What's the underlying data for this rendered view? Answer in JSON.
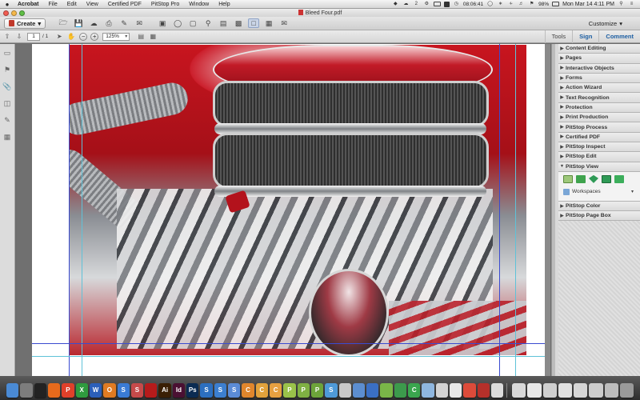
{
  "menubar": {
    "app": "Acrobat",
    "items": [
      "File",
      "Edit",
      "View",
      "Certified PDF",
      "PitStop Pro",
      "Window",
      "Help"
    ],
    "tray_count": "2",
    "clock_small": "08:06:41",
    "battery": "98%",
    "datetime": "Mon Mar 14  4:11 PM"
  },
  "window": {
    "title": "Bleed Four.pdf"
  },
  "toolbar": {
    "create_label": "Create",
    "customize_label": "Customize"
  },
  "navbar": {
    "page_current": "1",
    "page_total": "/ 1",
    "zoom": "125%",
    "tabs": [
      "Tools",
      "Sign",
      "Comment"
    ]
  },
  "panel": {
    "items_top": [
      "Content Editing",
      "Pages",
      "Interactive Objects",
      "Forms",
      "Action Wizard",
      "Text Recognition",
      "Protection",
      "Print Production",
      "PitStop Process",
      "Certified PDF",
      "PitStop Inspect",
      "PitStop Edit",
      "PitStop View"
    ],
    "workspaces_label": "Workspaces",
    "items_bottom": [
      "PitStop Color",
      "PitStop Page Box"
    ]
  },
  "dock": {
    "icons": [
      {
        "name": "finder",
        "glyph": "",
        "color": "#4a8ad4"
      },
      {
        "name": "system-preferences",
        "glyph": "",
        "color": "#7d7d7d"
      },
      {
        "name": "terminal",
        "glyph": "",
        "color": "#222222"
      },
      {
        "name": "firefox",
        "glyph": "",
        "color": "#e66a1c"
      },
      {
        "name": "app-p",
        "glyph": "P",
        "color": "#e0402a"
      },
      {
        "name": "app-x",
        "glyph": "X",
        "color": "#2f9b3e"
      },
      {
        "name": "app-w",
        "glyph": "W",
        "color": "#2b5fb9"
      },
      {
        "name": "app-o",
        "glyph": "O",
        "color": "#e07b22"
      },
      {
        "name": "app-s",
        "glyph": "S",
        "color": "#3a7bd5"
      },
      {
        "name": "app-s2",
        "glyph": "S",
        "color": "#c64a4a"
      },
      {
        "name": "acrobat",
        "glyph": "",
        "color": "#b51b1b"
      },
      {
        "name": "illustrator",
        "glyph": "Ai",
        "color": "#3a1f05"
      },
      {
        "name": "indesign",
        "glyph": "Id",
        "color": "#4a1032"
      },
      {
        "name": "photoshop",
        "glyph": "Ps",
        "color": "#0b2b52"
      },
      {
        "name": "app-s3",
        "glyph": "S",
        "color": "#2c6fbf"
      },
      {
        "name": "app-sp",
        "glyph": "S",
        "color": "#3c7fd0"
      },
      {
        "name": "app-s4",
        "glyph": "S",
        "color": "#5b8bd6"
      },
      {
        "name": "app-c",
        "glyph": "C",
        "color": "#e0862c"
      },
      {
        "name": "app-c2",
        "glyph": "C",
        "color": "#e2a23b"
      },
      {
        "name": "app-c3",
        "glyph": "C",
        "color": "#e6a040"
      },
      {
        "name": "app-p2",
        "glyph": "P",
        "color": "#9ac24a"
      },
      {
        "name": "app-p3",
        "glyph": "P",
        "color": "#7fb043"
      },
      {
        "name": "app-p4",
        "glyph": "P",
        "color": "#6da43a"
      },
      {
        "name": "app-s5",
        "glyph": "S",
        "color": "#4e9ad8"
      },
      {
        "name": "app-9",
        "glyph": "",
        "color": "#c8c8c8"
      },
      {
        "name": "app-10",
        "glyph": "",
        "color": "#5c8ed0"
      },
      {
        "name": "app-11",
        "glyph": "",
        "color": "#3a6fc4"
      },
      {
        "name": "app-12",
        "glyph": "",
        "color": "#7ab648"
      },
      {
        "name": "app-13",
        "glyph": "",
        "color": "#3c9a4c"
      },
      {
        "name": "app-c4",
        "glyph": "C",
        "color": "#3aa64e"
      },
      {
        "name": "app-14",
        "glyph": "",
        "color": "#8fb7e0"
      },
      {
        "name": "app-15",
        "glyph": "",
        "color": "#d3d3d3"
      },
      {
        "name": "app-16",
        "glyph": "",
        "color": "#e8e8e8"
      },
      {
        "name": "app-17",
        "glyph": "",
        "color": "#dc4b3a"
      },
      {
        "name": "filezilla",
        "glyph": "",
        "color": "#b5302a"
      },
      {
        "name": "app-18",
        "glyph": "",
        "color": "#dcdcdc"
      }
    ],
    "right_icons": [
      {
        "name": "folder-1",
        "color": "#d8d8d8"
      },
      {
        "name": "folder-2",
        "color": "#e8e8e8"
      },
      {
        "name": "folder-3",
        "color": "#cfcfcf"
      },
      {
        "name": "folder-4",
        "color": "#e0e0e0"
      },
      {
        "name": "folder-5",
        "color": "#d6d6d6"
      },
      {
        "name": "folder-6",
        "color": "#cccccc"
      },
      {
        "name": "folder-7",
        "color": "#bdbdbd"
      },
      {
        "name": "trash",
        "color": "#9a9a9a"
      }
    ]
  }
}
